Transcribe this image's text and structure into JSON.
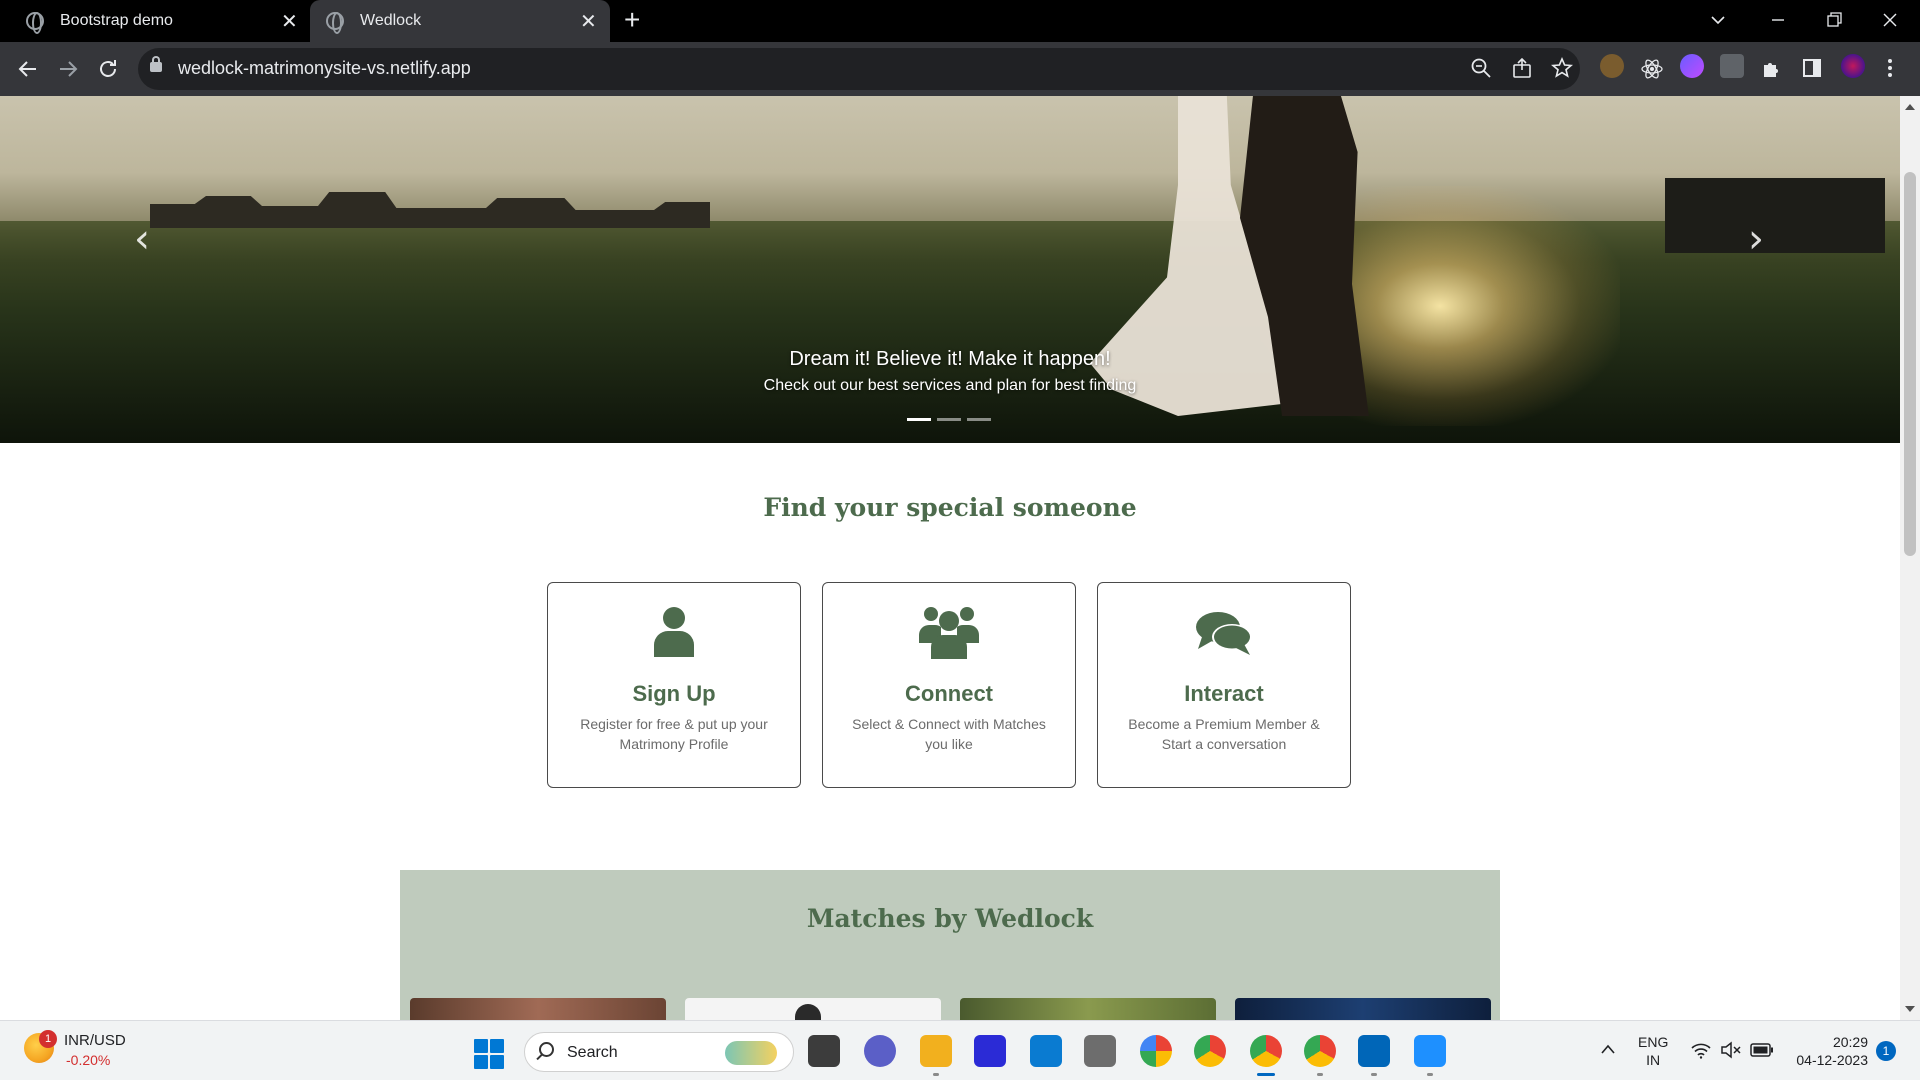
{
  "browser": {
    "tabs": [
      {
        "title": "Bootstrap demo",
        "active": false
      },
      {
        "title": "Wedlock",
        "active": true
      }
    ],
    "new_tab_symbol": "+",
    "close_symbol": "✕",
    "url": "wedlock-matrimonysite-vs.netlify.app"
  },
  "hero": {
    "caption_title": "Dream it! Believe it! Make it happen!",
    "caption_subtitle": "Check out our best services and plan for best finding",
    "slide_count": 3,
    "active_slide": 1,
    "prev_symbol": "‹",
    "next_symbol": "›"
  },
  "steps": {
    "title": "Find your special someone",
    "cards": [
      {
        "title": "Sign Up",
        "description": "Register for free & put up your Matrimony Profile",
        "icon": "user-icon"
      },
      {
        "title": "Connect",
        "description": "Select & Connect with Matches you like",
        "icon": "users-icon"
      },
      {
        "title": "Interact",
        "description": "Become a Premium Member & Start a conversation",
        "icon": "comments-icon"
      }
    ]
  },
  "matches": {
    "title": "Matches by Wedlock"
  },
  "taskbar": {
    "weather_badge": "1",
    "ticker": "INR/USD",
    "ticker_change": "-0.20%",
    "search_placeholder": "Search",
    "language_line1": "ENG",
    "language_line2": "IN",
    "time": "20:29",
    "date": "04-12-2023",
    "notifications": "1"
  },
  "colors": {
    "brand_green": "#4d6b4d",
    "matches_bg": "#bfcbbd",
    "card_border": "#4a4a4a"
  }
}
